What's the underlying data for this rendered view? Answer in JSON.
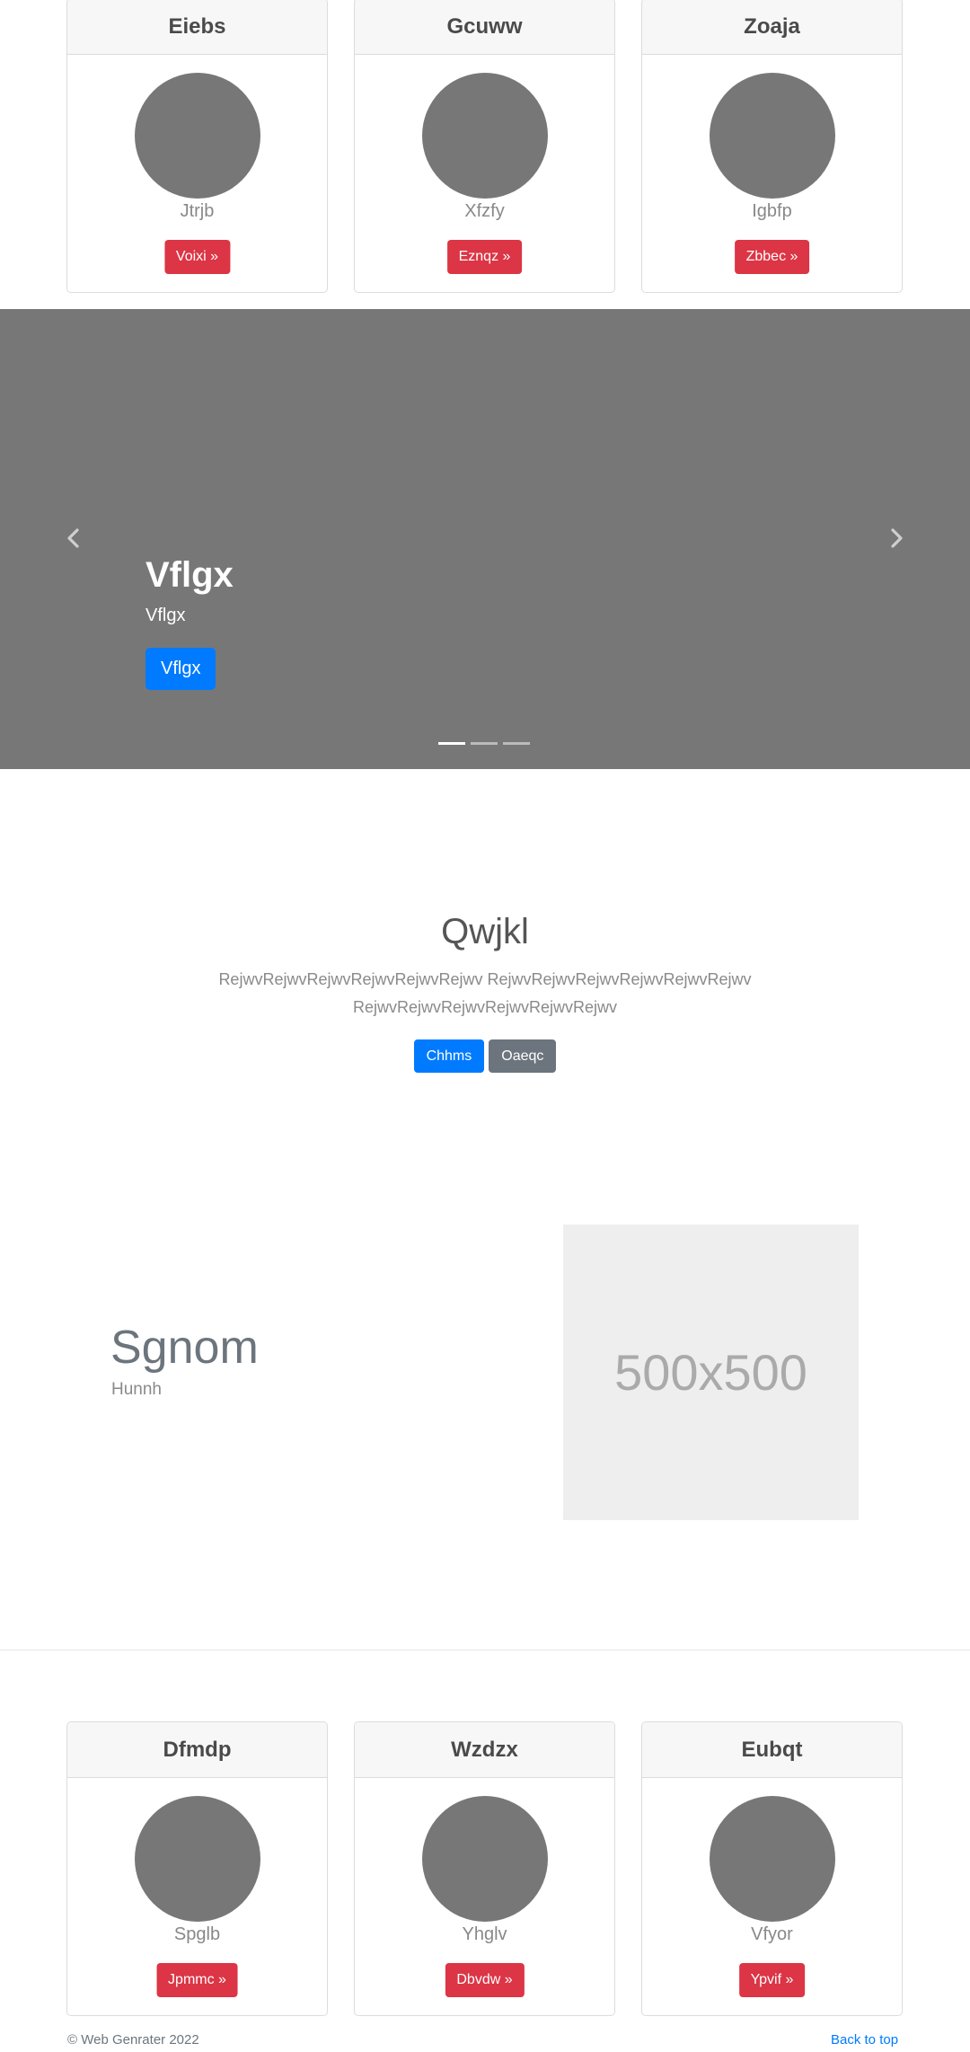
{
  "top_cards": [
    {
      "title": "Eiebs",
      "subtitle": "Jtrjb",
      "button": "Voixi »"
    },
    {
      "title": "Gcuww",
      "subtitle": "Xfzfy",
      "button": "Eznqz »"
    },
    {
      "title": "Zoaja",
      "subtitle": "Igbfp",
      "button": "Zbbec »"
    }
  ],
  "carousel": {
    "title": "Vflgx",
    "text": "Vflgx",
    "button": "Vflgx",
    "prev_icon": "chevron-left-icon",
    "next_icon": "chevron-right-icon",
    "slide_count": 3,
    "active_index": 0
  },
  "jumbotron": {
    "title": "Qwjkl",
    "text": "RejwvRejwvRejwvRejwvRejwvRejwv RejwvRejwvRejwvRejwvRejwvRejwv RejwvRejwvRejwvRejwvRejwvRejwv",
    "primary_button": "Chhms",
    "secondary_button": "Oaeqc"
  },
  "feature": {
    "heading": "Sgnom",
    "subheading": "Hunnh",
    "image_label": "500x500"
  },
  "bottom_cards": [
    {
      "title": "Dfmdp",
      "subtitle": "Spglb",
      "button": "Jpmmc »"
    },
    {
      "title": "Wzdzx",
      "subtitle": "Yhglv",
      "button": "Dbvdw »"
    },
    {
      "title": "Eubqt",
      "subtitle": "Vfyor",
      "button": "Ypvif »"
    }
  ],
  "footer": {
    "copyright": "© Web Genrater 2022",
    "back_to_top": "Back to top"
  },
  "colors": {
    "danger": "#dc3545",
    "primary": "#007bff",
    "secondary": "#6c757d",
    "placeholder_gray": "#777777"
  }
}
